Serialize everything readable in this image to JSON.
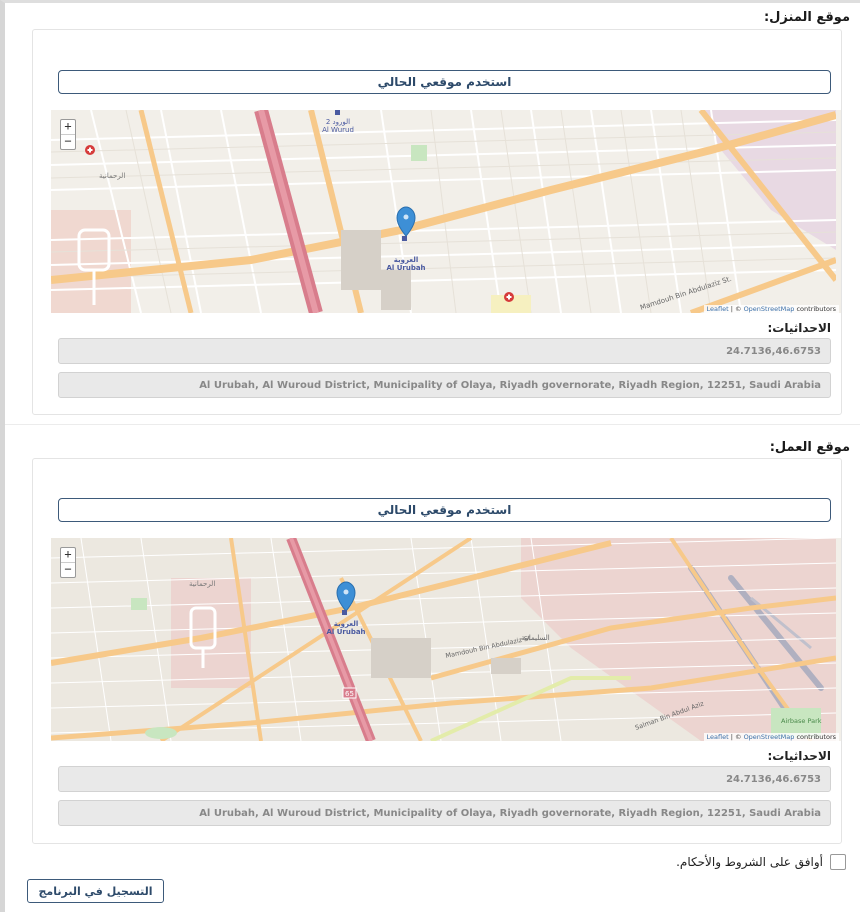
{
  "home": {
    "title": "موقع المنزل:",
    "use_location_label": "استخدم موقعي الحالي",
    "coords_label": "الاحداثيات:",
    "coords_value": "24.7136,46.6753",
    "address_value": "Al Urubah, Al Wuroud District, Municipality of Olaya, Riyadh governorate, Riyadh Region, 12251, Saudi Arabia",
    "map": {
      "zoom_in": "+",
      "zoom_out": "−",
      "attrib_leaflet": "Leaflet",
      "attrib_sep": " | © ",
      "attrib_osm": "OpenStreetMap",
      "attrib_contrib": " contributors",
      "marker_label_ar": "العروبة",
      "marker_label_en": "Al Urubah",
      "place_label_ar": "الورود 2",
      "place_label_en": "Al Wurud",
      "district_label": "الرحمانية",
      "street_label": "Mamdouh Bin Abdulaziz St."
    }
  },
  "work": {
    "title": "موقع العمل:",
    "use_location_label": "استخدم موقعي الحالي",
    "coords_label": "الاحداثيات:",
    "coords_value": "24.7136,46.6753",
    "address_value": "Al Urubah, Al Wuroud District, Municipality of Olaya, Riyadh governorate, Riyadh Region, 12251, Saudi Arabia",
    "map": {
      "zoom_in": "+",
      "zoom_out": "−",
      "attrib_leaflet": "Leaflet",
      "attrib_sep": " | © ",
      "attrib_osm": "OpenStreetMap",
      "attrib_contrib": " contributors",
      "marker_label_ar": "العروبة",
      "marker_label_en": "Al Urubah",
      "district_label": "الرحمانية",
      "district2_label": "السليمانية",
      "street_label": "Mamdouh Bin Abdulaziz St.",
      "street2_label": "Salman Bin Abdul Aziz",
      "park_label": "Airbase Park",
      "road_number": "65"
    }
  },
  "terms_label": "أوافق على الشروط والأحكام.",
  "submit_label": "التسجيل في البرنامج",
  "colors": {
    "accent": "#2d4a6a",
    "map_road": "#f7c98a",
    "map_major": "#d87d8c",
    "marker": "#3d8fd6"
  }
}
